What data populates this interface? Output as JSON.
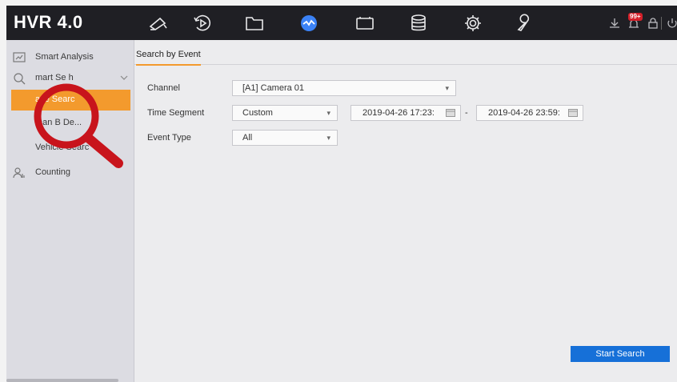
{
  "app": {
    "logo": "HVR 4.0"
  },
  "topbar": {
    "icons": [
      "live-view-camera-icon",
      "playback-icon",
      "file-folder-icon",
      "smart-analysis-icon",
      "camera-device-icon",
      "storage-icon",
      "configuration-gear-icon",
      "maintenance-wrench-icon"
    ],
    "active_icon": "smart-analysis-icon",
    "status": {
      "alarm_badge": "99+"
    },
    "accent": "#3b82f6"
  },
  "sidebar": {
    "items": [
      {
        "label": "Smart Analysis",
        "icon": "smart-analysis-icon"
      },
      {
        "label": "Smart Search",
        "icon": "smart-search-icon",
        "obscured_label": "mart Se  h"
      },
      {
        "label": "Face Search",
        "visible": "ace Searc",
        "active": true
      },
      {
        "label": "Human Body",
        "visible": "man B   De..."
      },
      {
        "label": "Vehicle Search",
        "visible": "Vehicle Searc"
      },
      {
        "label": "Counting",
        "icon": "counting-icon"
      }
    ]
  },
  "main": {
    "tab": "Search by Event",
    "channel_label": "Channel",
    "channel_value": "[A1] Camera 01",
    "time_segment_label": "Time Segment",
    "time_segment_value": "Custom",
    "start_time": "2019-04-26 17:23:",
    "end_time": "2019-04-26 23:59:",
    "date_separator": "-",
    "event_type_label": "Event Type",
    "event_type_value": "All",
    "start_button": "Start Search"
  },
  "colors": {
    "active_orange": "#f39a2d",
    "button_blue": "#1670d8",
    "magnifier_red": "#c8141c"
  }
}
